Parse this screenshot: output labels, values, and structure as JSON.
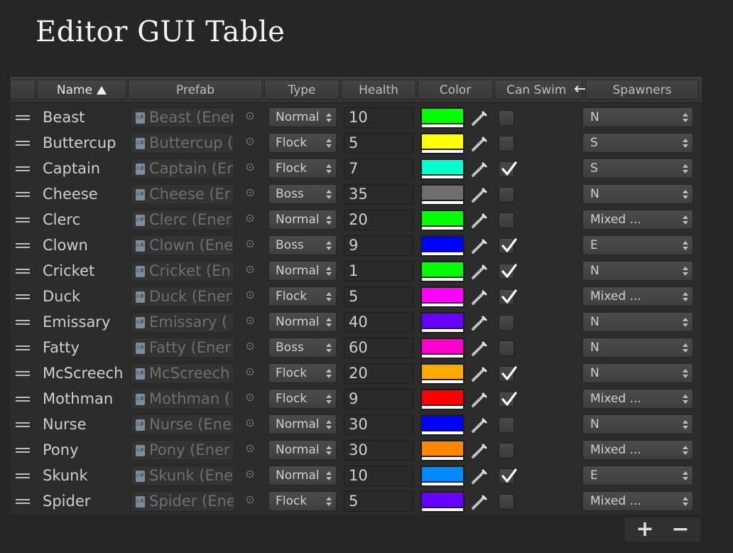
{
  "title": "Editor GUI Table",
  "columns": {
    "name": "Name",
    "prefab": "Prefab",
    "type": "Type",
    "health": "Health",
    "color": "Color",
    "can_swim": "Can Swim",
    "spawners": "Spawners"
  },
  "sort": {
    "column": "name",
    "direction": "ascending",
    "icon": "sort-ascending-icon"
  },
  "rows": [
    {
      "name": "Beast",
      "prefab": "Beast (Ener",
      "type": "Normal",
      "health": "10",
      "color": "#00ff00",
      "can_swim": false,
      "spawners": "N"
    },
    {
      "name": "Buttercup",
      "prefab": "Buttercup (",
      "type": "Flock",
      "health": "5",
      "color": "#ffff00",
      "can_swim": false,
      "spawners": "S"
    },
    {
      "name": "Captain",
      "prefab": "Captain (Er",
      "type": "Flock",
      "health": "7",
      "color": "#00ffcc",
      "can_swim": true,
      "spawners": "S"
    },
    {
      "name": "Cheese",
      "prefab": "Cheese (Er",
      "type": "Boss",
      "health": "35",
      "color": "#6e6e6e",
      "can_swim": false,
      "spawners": "N"
    },
    {
      "name": "Clerc",
      "prefab": "Clerc (Ener",
      "type": "Normal",
      "health": "20",
      "color": "#00ff00",
      "can_swim": false,
      "spawners": "Mixed ..."
    },
    {
      "name": "Clown",
      "prefab": "Clown (Ene",
      "type": "Boss",
      "health": "9",
      "color": "#0000ff",
      "can_swim": true,
      "spawners": "E"
    },
    {
      "name": "Cricket",
      "prefab": "Cricket (En",
      "type": "Normal",
      "health": "1",
      "color": "#00ff00",
      "can_swim": true,
      "spawners": "N"
    },
    {
      "name": "Duck",
      "prefab": "Duck (Ener",
      "type": "Flock",
      "health": "5",
      "color": "#ff00ff",
      "can_swim": true,
      "spawners": "Mixed ..."
    },
    {
      "name": "Emissary",
      "prefab": "Emissary (",
      "type": "Normal",
      "health": "40",
      "color": "#6600ff",
      "can_swim": false,
      "spawners": "N"
    },
    {
      "name": "Fatty",
      "prefab": "Fatty (Ener",
      "type": "Boss",
      "health": "60",
      "color": "#ff00cc",
      "can_swim": false,
      "spawners": "N"
    },
    {
      "name": "McScreech",
      "prefab": "McScreech",
      "type": "Flock",
      "health": "20",
      "color": "#ffaa00",
      "can_swim": true,
      "spawners": "N"
    },
    {
      "name": "Mothman",
      "prefab": "Mothman (",
      "type": "Flock",
      "health": "9",
      "color": "#ff0000",
      "can_swim": true,
      "spawners": "Mixed ..."
    },
    {
      "name": "Nurse",
      "prefab": "Nurse (Ene",
      "type": "Normal",
      "health": "30",
      "color": "#0000ff",
      "can_swim": false,
      "spawners": "N"
    },
    {
      "name": "Pony",
      "prefab": "Pony (Ener",
      "type": "Normal",
      "health": "30",
      "color": "#ff8800",
      "can_swim": false,
      "spawners": "Mixed ..."
    },
    {
      "name": "Skunk",
      "prefab": "Skunk (Ene",
      "type": "Normal",
      "health": "10",
      "color": "#0088ff",
      "can_swim": true,
      "spawners": "E"
    },
    {
      "name": "Spider",
      "prefab": "Spider (Ene",
      "type": "Flock",
      "health": "5",
      "color": "#6600ff",
      "can_swim": false,
      "spawners": "Mixed ..."
    }
  ],
  "footer": {
    "add_label": "+",
    "remove_label": "−"
  }
}
